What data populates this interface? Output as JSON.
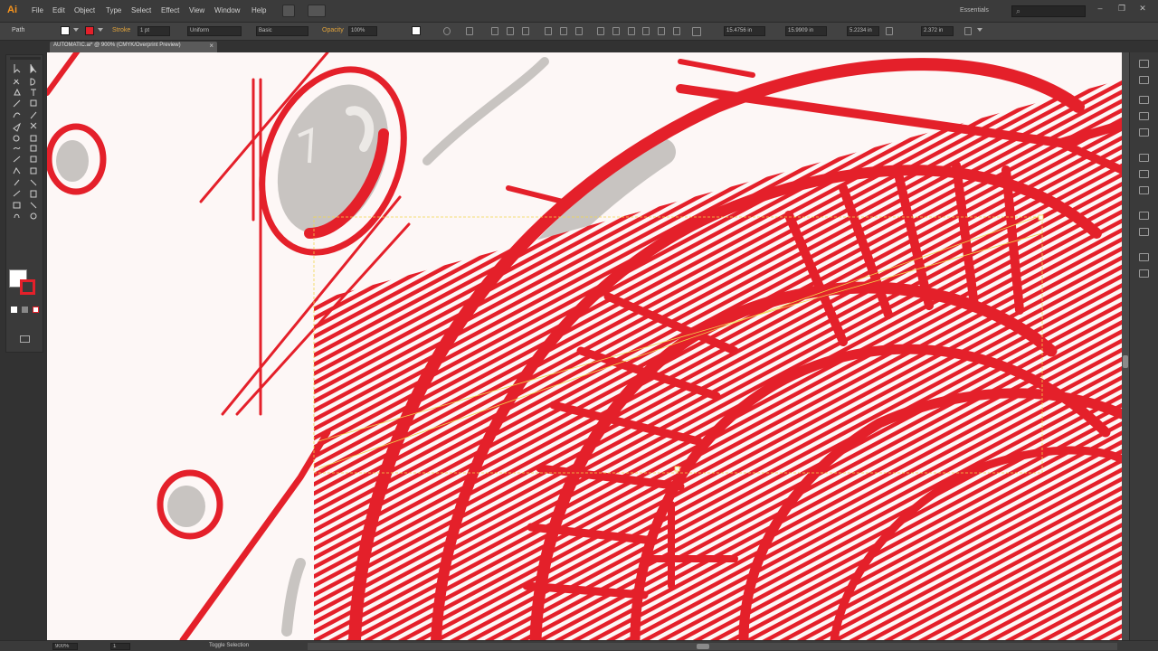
{
  "app": {
    "logo": "Ai"
  },
  "menu": [
    "File",
    "Edit",
    "Object",
    "Type",
    "Select",
    "Effect",
    "View",
    "Window",
    "Help"
  ],
  "workspace": "Essentials",
  "window_controls": {
    "minimize": "–",
    "maximize": "❐",
    "close": "✕"
  },
  "control_bar": {
    "selection_label": "Path",
    "stroke_label": "Stroke",
    "stroke_weight": "1 pt",
    "profile": "Uniform",
    "brush": "Basic",
    "opacity_label": "Opacity",
    "opacity": "100%",
    "x_value": "15.4756 in",
    "y_value": "15.9909 in",
    "w_value": "5.2234 in",
    "h_value": "2.372 in"
  },
  "document": {
    "tab_title": "AUTOMATIC.ai* @ 900% (CMYK/Overprint Preview)",
    "tab_close": "×"
  },
  "status": {
    "zoom": "900%",
    "page": "1",
    "text": "Toggle Selection"
  },
  "colors": {
    "art_red": "#e4202a",
    "art_gray": "#c8c4c1",
    "paper": "#fdf7f6",
    "selection": "#f2d64c",
    "ui_dark": "#323232",
    "logo_orange": "#f7941d"
  }
}
